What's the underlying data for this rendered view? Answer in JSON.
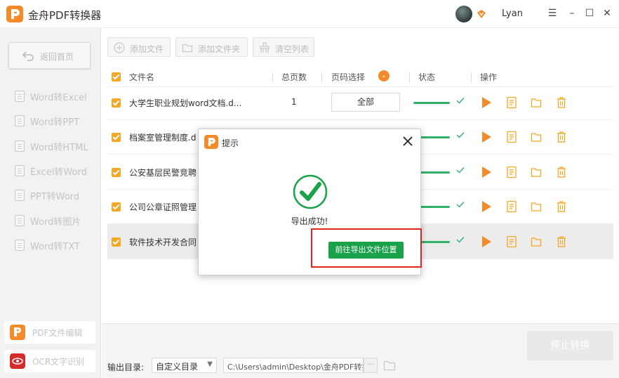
{
  "app": {
    "title": "金舟PDF转换器",
    "username": "Lyan",
    "colors": {
      "brand_orange": "#f58a2a",
      "success_green": "#1aa24a",
      "highlight_red": "#e0241f"
    }
  },
  "window_controls": {
    "menu": "☰",
    "minimize": "–",
    "maximize": "☐",
    "close": "✕"
  },
  "sidebar": {
    "back_label": "返回首页",
    "items": [
      {
        "label": "Word转Excel"
      },
      {
        "label": "Word转PPT"
      },
      {
        "label": "Word转HTML"
      },
      {
        "label": "Excel转Word"
      },
      {
        "label": "PPT转Word"
      },
      {
        "label": "Word转图片"
      },
      {
        "label": "Word转TXT"
      }
    ],
    "tools": [
      {
        "label": "PDF文件编辑"
      },
      {
        "label": "OCR文字识别"
      }
    ]
  },
  "toolbar": {
    "add_file": "添加文件",
    "add_folder": "添加文件夹",
    "clear_list": "清空列表"
  },
  "table": {
    "headers": {
      "filename": "文件名",
      "pages": "总页数",
      "page_range": "页码选择",
      "status": "状态",
      "actions": "操作"
    },
    "rows": [
      {
        "filename": "大学生职业规划word文档.d...",
        "pages": "1",
        "range": "全部",
        "progress": 1.0
      },
      {
        "filename": "档案室管理制度.d",
        "pages": "",
        "range": "",
        "progress": 1.0
      },
      {
        "filename": "公安基层民警竞聘",
        "pages": "",
        "range": "",
        "progress": 1.0
      },
      {
        "filename": "公司公章证照管理",
        "pages": "",
        "range": "",
        "progress": 1.0
      },
      {
        "filename": "软件技术开发合同",
        "pages": "",
        "range": "",
        "progress": 1.0
      }
    ]
  },
  "footer": {
    "output_label": "输出目录:",
    "output_option": "自定义目录",
    "output_path": "C:\\Users\\admin\\Desktop\\金舟PDF转换",
    "more": "···",
    "stop_label": "停止转换"
  },
  "dialog": {
    "title": "提示",
    "message": "导出成功!",
    "goto_label": "前往导出文件位置"
  }
}
